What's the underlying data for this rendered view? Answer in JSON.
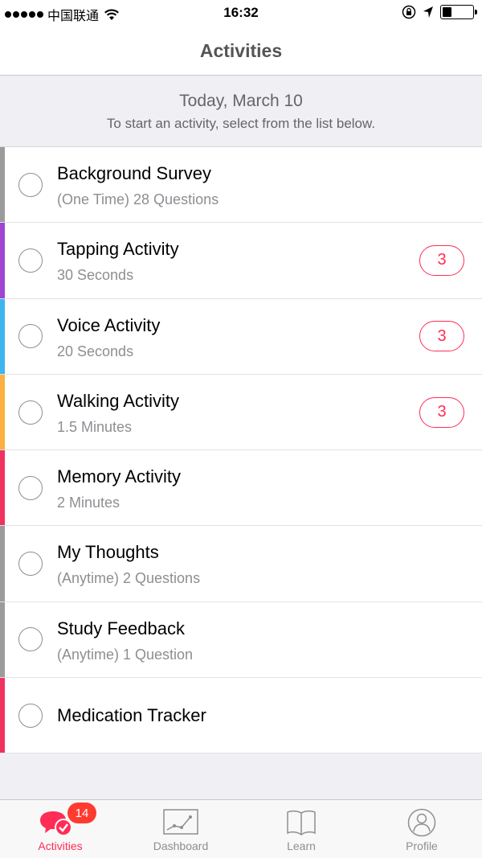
{
  "status_bar": {
    "carrier": "中国联通",
    "time": "16:32",
    "battery_level": 0.3,
    "icons": [
      "signal-dots-icon",
      "wifi-icon",
      "orientation-lock-icon",
      "location-arrow-icon",
      "battery-icon"
    ]
  },
  "nav": {
    "title": "Activities"
  },
  "header": {
    "date": "Today, March 10",
    "hint": "To start an activity, select from the list below."
  },
  "activities": [
    {
      "title": "Background Survey",
      "subtitle": "(One Time) 28 Questions",
      "color": "#9b9b9b",
      "badge": ""
    },
    {
      "title": "Tapping Activity",
      "subtitle": "30 Seconds",
      "color": "#9f44d3",
      "badge": "3"
    },
    {
      "title": "Voice Activity",
      "subtitle": "20 Seconds",
      "color": "#3cb5f0",
      "badge": "3"
    },
    {
      "title": "Walking Activity",
      "subtitle": "1.5 Minutes",
      "color": "#fcb040",
      "badge": "3"
    },
    {
      "title": "Memory Activity",
      "subtitle": "2 Minutes",
      "color": "#f0325f",
      "badge": ""
    },
    {
      "title": "My Thoughts",
      "subtitle": "(Anytime) 2 Questions",
      "color": "#9b9b9b",
      "badge": ""
    },
    {
      "title": "Study Feedback",
      "subtitle": "(Anytime) 1 Question",
      "color": "#9b9b9b",
      "badge": ""
    },
    {
      "title": "Medication Tracker",
      "subtitle": "",
      "color": "#f0325f",
      "badge": ""
    }
  ],
  "tabs": [
    {
      "label": "Activities",
      "icon": "chat-bubble-check-icon",
      "badge": "14",
      "active": true
    },
    {
      "label": "Dashboard",
      "icon": "chart-icon",
      "badge": "",
      "active": false
    },
    {
      "label": "Learn",
      "icon": "book-icon",
      "badge": "",
      "active": false
    },
    {
      "label": "Profile",
      "icon": "person-icon",
      "badge": "",
      "active": false
    }
  ],
  "colors": {
    "accent": "#ff2d55",
    "badge_red": "#ff3b30",
    "tab_inactive": "#8e8e93"
  }
}
